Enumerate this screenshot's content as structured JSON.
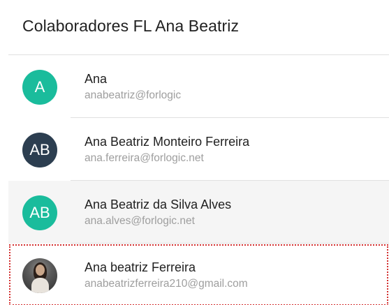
{
  "header": {
    "title": "Colaboradores FL Ana Beatriz"
  },
  "colors": {
    "avatar_teal": "#1abc9c",
    "avatar_navy": "#2c3e50",
    "selection_outline": "#d32f2f"
  },
  "collaborators": [
    {
      "initials": "A",
      "name": "Ana",
      "email": "anabeatriz@forlogic",
      "avatar_color": "#1abc9c"
    },
    {
      "initials": "AB",
      "name": "Ana Beatriz Monteiro Ferreira",
      "email": "ana.ferreira@forlogic.net",
      "avatar_color": "#2c3e50"
    },
    {
      "initials": "AB",
      "name": "Ana Beatriz da Silva Alves",
      "email": "ana.alves@forlogic.net",
      "avatar_color": "#1abc9c"
    },
    {
      "initials": "",
      "name": "Ana beatriz Ferreira",
      "email": "anabeatrizferreira210@gmail.com",
      "avatar": "photo"
    }
  ]
}
